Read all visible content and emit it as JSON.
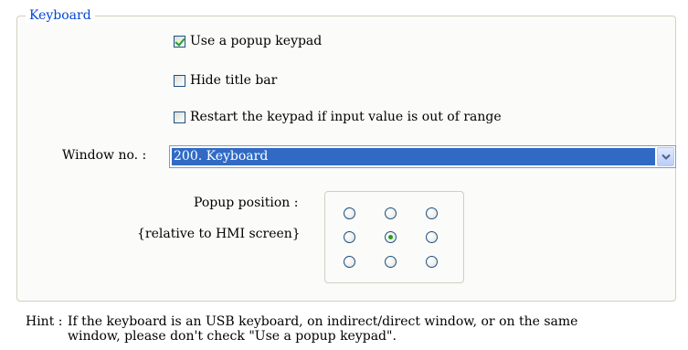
{
  "group": {
    "title": "Keyboard"
  },
  "checkboxes": [
    {
      "label": "Use a popup keypad",
      "checked": true
    },
    {
      "label": "Hide title bar",
      "checked": false
    },
    {
      "label": "Restart the keypad if input value is out of range",
      "checked": false
    }
  ],
  "window": {
    "label": "Window no. :",
    "selected_value": "200. Keyboard"
  },
  "popup_position": {
    "label": "Popup position :",
    "sublabel": "{relative to HMI screen}",
    "options": [
      "top-left",
      "top-center",
      "top-right",
      "middle-left",
      "center",
      "middle-right",
      "bottom-left",
      "bottom-center",
      "bottom-right"
    ],
    "selected": "center"
  },
  "hint": {
    "label": "Hint :",
    "line1": "If the keyboard is an USB keyboard, on indirect/direct window, or on the same",
    "line2": "window, please don't check \"Use a popup keypad\"."
  },
  "colors": {
    "group_title": "#0046d5",
    "selection": "#316ac5",
    "check_mark": "#21a121",
    "control_border": "#1c5180"
  }
}
